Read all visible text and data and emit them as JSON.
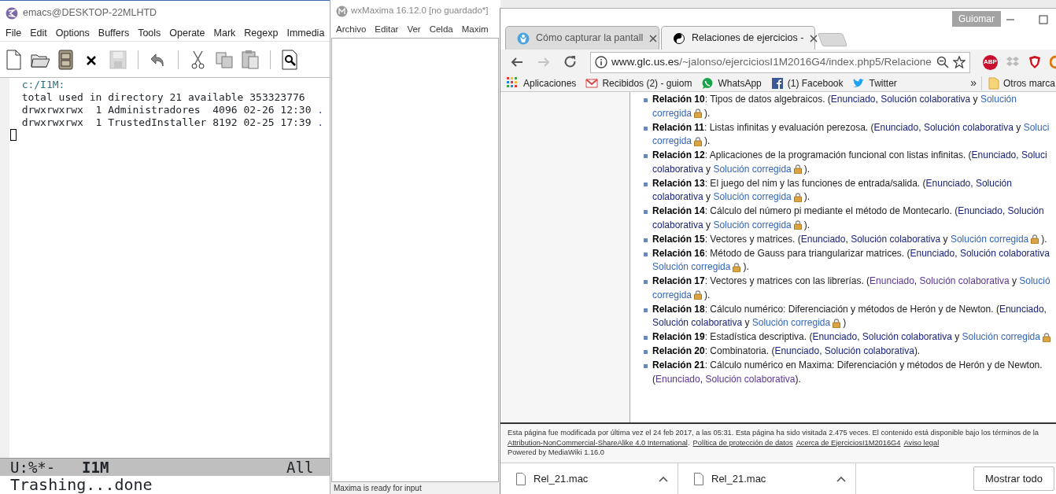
{
  "emacs": {
    "title": "emacs@DESKTOP-22MLHTD",
    "menu": [
      "File",
      "Edit",
      "Options",
      "Buffers",
      "Tools",
      "Operate",
      "Mark",
      "Regexp",
      "Immedia"
    ],
    "toolbar": [
      {
        "kind": "new",
        "disabled": false
      },
      {
        "kind": "open",
        "disabled": false
      },
      {
        "kind": "dired",
        "disabled": false
      },
      {
        "kind": "close",
        "disabled": false
      },
      {
        "kind": "save",
        "disabled": true
      },
      {
        "kind": "separator"
      },
      {
        "kind": "undo",
        "disabled": false
      },
      {
        "kind": "separator"
      },
      {
        "kind": "cut",
        "disabled": false
      },
      {
        "kind": "copy",
        "disabled": false
      },
      {
        "kind": "paste",
        "disabled": false
      },
      {
        "kind": "separator"
      },
      {
        "kind": "search",
        "disabled": false
      }
    ],
    "lines": [
      {
        "kind": "header",
        "text": "c:/I1M:"
      },
      {
        "kind": "plain",
        "text": "total used in directory 21 available 353323776"
      },
      {
        "kind": "entry",
        "text": "drwxrwxrwx  1 Administradores  4096 02-26 12:30",
        "name": "."
      },
      {
        "kind": "entry",
        "text": "drwxrwxrwx  1 TrustedInstaller 8192 02-25 17:39",
        "name": "."
      }
    ],
    "mode_line": {
      "status": "U:%*-",
      "buffer": "I1M",
      "position": "All"
    },
    "echo": "Trashing...done"
  },
  "maxima": {
    "title": "wxMaxima 16.12.0 [no guardado*]",
    "menu": [
      "Archivo",
      "Editar",
      "Ver",
      "Celda",
      "Maxim"
    ],
    "status": "Maxima is ready for input"
  },
  "browser": {
    "profile": "Guiomar",
    "tabs": [
      {
        "kind": "person",
        "title": "Cómo capturar la pantall",
        "selected": false
      },
      {
        "kind": "wiki",
        "title": "Relaciones de ejercicios -",
        "selected": true
      }
    ],
    "nav": [
      {
        "kind": "back",
        "disabled": false
      },
      {
        "kind": "forward",
        "disabled": true
      },
      {
        "kind": "reload",
        "disabled": false
      }
    ],
    "url": {
      "host": "www.glc.us.es",
      "path": "/~jalonso/ejerciciosI1M2016G4/index.php5/Relacione"
    },
    "extensions": [
      {
        "kind": "abp",
        "label": "ABP"
      },
      {
        "kind": "dropbox"
      },
      {
        "kind": "shield"
      },
      {
        "kind": "ring"
      }
    ],
    "bookmarks": [
      {
        "kind": "apps",
        "label": "Aplicaciones"
      },
      {
        "kind": "gmail",
        "label": "Recibidos (2) - guiom"
      },
      {
        "kind": "whatsapp",
        "label": "WhatsApp"
      },
      {
        "kind": "facebook",
        "label": "(1) Facebook"
      },
      {
        "kind": "twitter",
        "label": "Twitter"
      }
    ],
    "bookmarks_more": "»",
    "other_bookmarks": "Otros marca",
    "relations": [
      {
        "lines": [
          [
            {
              "kind": "label",
              "text": "Relación 10"
            },
            {
              "kind": "text",
              "text": ": Tipos de datos algebraicos. ("
            },
            {
              "kind": "visited",
              "text": "Enunciado"
            },
            {
              "kind": "text",
              "text": ", "
            },
            {
              "kind": "visited",
              "text": "Solución colaborativa"
            },
            {
              "kind": "text",
              "text": " y "
            },
            {
              "kind": "link",
              "text": "Solución"
            }
          ],
          [
            {
              "kind": "link",
              "text": "corregida"
            },
            {
              "kind": "lock"
            },
            {
              "kind": "text",
              "text": ")."
            }
          ]
        ]
      },
      {
        "lines": [
          [
            {
              "kind": "label",
              "text": "Relación 11"
            },
            {
              "kind": "text",
              "text": ": Listas infinitas y evaluación perezosa. ("
            },
            {
              "kind": "visited",
              "text": "Enunciado"
            },
            {
              "kind": "text",
              "text": ", "
            },
            {
              "kind": "visited",
              "text": "Solución colaborativa"
            },
            {
              "kind": "text",
              "text": " y "
            },
            {
              "kind": "link",
              "text": "Soluci"
            }
          ],
          [
            {
              "kind": "link",
              "text": "corregida"
            },
            {
              "kind": "lock"
            },
            {
              "kind": "text",
              "text": ")."
            }
          ]
        ]
      },
      {
        "lines": [
          [
            {
              "kind": "label",
              "text": "Relación 12"
            },
            {
              "kind": "text",
              "text": ": Aplicaciones de la programación funcional con listas infinitas. ("
            },
            {
              "kind": "visited",
              "text": "Enunciado"
            },
            {
              "kind": "text",
              "text": ", "
            },
            {
              "kind": "visited",
              "text": "Soluci"
            }
          ],
          [
            {
              "kind": "visited",
              "text": "colaborativa"
            },
            {
              "kind": "text",
              "text": " y "
            },
            {
              "kind": "link",
              "text": "Solución corregida"
            },
            {
              "kind": "lock"
            },
            {
              "kind": "text",
              "text": ")."
            }
          ]
        ]
      },
      {
        "lines": [
          [
            {
              "kind": "label",
              "text": "Relación 13"
            },
            {
              "kind": "text",
              "text": ": El juego del nim y las funciones de entrada/salida. ("
            },
            {
              "kind": "visited",
              "text": "Enunciado"
            },
            {
              "kind": "text",
              "text": ", "
            },
            {
              "kind": "visited",
              "text": "Solución"
            }
          ],
          [
            {
              "kind": "visited",
              "text": "colaborativa"
            },
            {
              "kind": "text",
              "text": " y "
            },
            {
              "kind": "link",
              "text": "Solución corregida"
            },
            {
              "kind": "lock"
            },
            {
              "kind": "text",
              "text": ")."
            }
          ]
        ]
      },
      {
        "lines": [
          [
            {
              "kind": "label",
              "text": "Relación 14"
            },
            {
              "kind": "text",
              "text": ": Cálculo del número pi mediante el método de Montecarlo. ("
            },
            {
              "kind": "visited",
              "text": "Enunciado"
            },
            {
              "kind": "text",
              "text": ", "
            },
            {
              "kind": "visited",
              "text": "Solución"
            }
          ],
          [
            {
              "kind": "visited",
              "text": "colaborativa"
            },
            {
              "kind": "text",
              "text": " y "
            },
            {
              "kind": "link",
              "text": "Solución corregida"
            },
            {
              "kind": "lock"
            },
            {
              "kind": "text",
              "text": ")."
            }
          ]
        ]
      },
      {
        "lines": [
          [
            {
              "kind": "label",
              "text": "Relación 15"
            },
            {
              "kind": "text",
              "text": ": Vectores y matrices. ("
            },
            {
              "kind": "visited",
              "text": "Enunciado"
            },
            {
              "kind": "text",
              "text": ", "
            },
            {
              "kind": "visited",
              "text": "Solución colaborativa"
            },
            {
              "kind": "text",
              "text": " y "
            },
            {
              "kind": "link",
              "text": "Solución corregida"
            },
            {
              "kind": "lock"
            },
            {
              "kind": "text",
              "text": ")."
            }
          ]
        ]
      },
      {
        "lines": [
          [
            {
              "kind": "label",
              "text": "Relación 16"
            },
            {
              "kind": "text",
              "text": ": Método de Gauss para triangularizar matrices. ("
            },
            {
              "kind": "visited",
              "text": "Enunciado"
            },
            {
              "kind": "text",
              "text": ", "
            },
            {
              "kind": "visited",
              "text": "Solución colaborativa"
            }
          ],
          [
            {
              "kind": "link",
              "text": "Solución corregida"
            },
            {
              "kind": "lock"
            },
            {
              "kind": "text",
              "text": ")."
            }
          ]
        ]
      },
      {
        "lines": [
          [
            {
              "kind": "label",
              "text": "Relación 17"
            },
            {
              "kind": "text",
              "text": ": Vectores y matrices con las librerías. ("
            },
            {
              "kind": "active",
              "text": "Enunciado"
            },
            {
              "kind": "text",
              "text": ", "
            },
            {
              "kind": "active",
              "text": "Solución colaborativa"
            },
            {
              "kind": "text",
              "text": " y "
            },
            {
              "kind": "link",
              "text": "Solució"
            }
          ],
          [
            {
              "kind": "link",
              "text": "corregida"
            },
            {
              "kind": "lock"
            },
            {
              "kind": "text",
              "text": ")."
            }
          ]
        ]
      },
      {
        "lines": [
          [
            {
              "kind": "label",
              "text": "Relación 18"
            },
            {
              "kind": "text",
              "text": ": Cálculo numérico: Diferenciación y métodos de Herón y de Newton. ("
            },
            {
              "kind": "visited",
              "text": "Enunciado"
            },
            {
              "kind": "text",
              "text": ","
            }
          ],
          [
            {
              "kind": "visited",
              "text": "Solución colaborativa"
            },
            {
              "kind": "text",
              "text": " y "
            },
            {
              "kind": "link",
              "text": "Solución corregida"
            },
            {
              "kind": "lock"
            },
            {
              "kind": "text",
              "text": ")"
            }
          ]
        ]
      },
      {
        "lines": [
          [
            {
              "kind": "label",
              "text": "Relación 19"
            },
            {
              "kind": "text",
              "text": ": Estadística descriptiva. ("
            },
            {
              "kind": "visited",
              "text": "Enunciado"
            },
            {
              "kind": "text",
              "text": ", "
            },
            {
              "kind": "visited",
              "text": "Solución colaborativa"
            },
            {
              "kind": "text",
              "text": " y "
            },
            {
              "kind": "link",
              "text": "Solución corregida"
            },
            {
              "kind": "lock"
            }
          ]
        ]
      },
      {
        "lines": [
          [
            {
              "kind": "label",
              "text": "Relación 20"
            },
            {
              "kind": "text",
              "text": ": Combinatoria. ("
            },
            {
              "kind": "visited",
              "text": "Enunciado"
            },
            {
              "kind": "text",
              "text": ", "
            },
            {
              "kind": "visited",
              "text": "Solución colaborativa"
            },
            {
              "kind": "text",
              "text": ")."
            }
          ]
        ]
      },
      {
        "lines": [
          [
            {
              "kind": "label",
              "text": "Relación 21"
            },
            {
              "kind": "text",
              "text": ": Cálculo numérico en Maxima: Diferenciación y métodos de Herón y de Newton."
            }
          ],
          [
            {
              "kind": "text",
              "text": "("
            },
            {
              "kind": "active",
              "text": "Enunciado"
            },
            {
              "kind": "text",
              "text": ", "
            },
            {
              "kind": "active",
              "text": "Solución colaborativa"
            },
            {
              "kind": "text",
              "text": ")."
            }
          ]
        ]
      }
    ],
    "footer": [
      [
        {
          "kind": "text",
          "text": "Esta página fue modificada por última vez el 24 feb 2017, a las 05:31. Esta página ha sido visitada 2.475 veces. El contenido está disponible bajo los términos de la"
        }
      ],
      [
        {
          "kind": "link",
          "text": "Attribution-NonCommercial-ShareAlike 4.0 International"
        },
        {
          "kind": "text",
          "text": "."
        },
        {
          "kind": "link",
          "text": "Política de protección de datos"
        },
        {
          "kind": "link",
          "text": "Acerca de EjerciciosI1M2016G4"
        },
        {
          "kind": "link",
          "text": "Aviso legal"
        }
      ],
      [
        {
          "kind": "text",
          "text": "Powered by MediaWiki 1.16.0"
        }
      ]
    ],
    "downloads": [
      {
        "name": "Rel_21.mac"
      },
      {
        "name": "Rel_21.mac"
      }
    ],
    "show_all": "Mostrar todo"
  }
}
